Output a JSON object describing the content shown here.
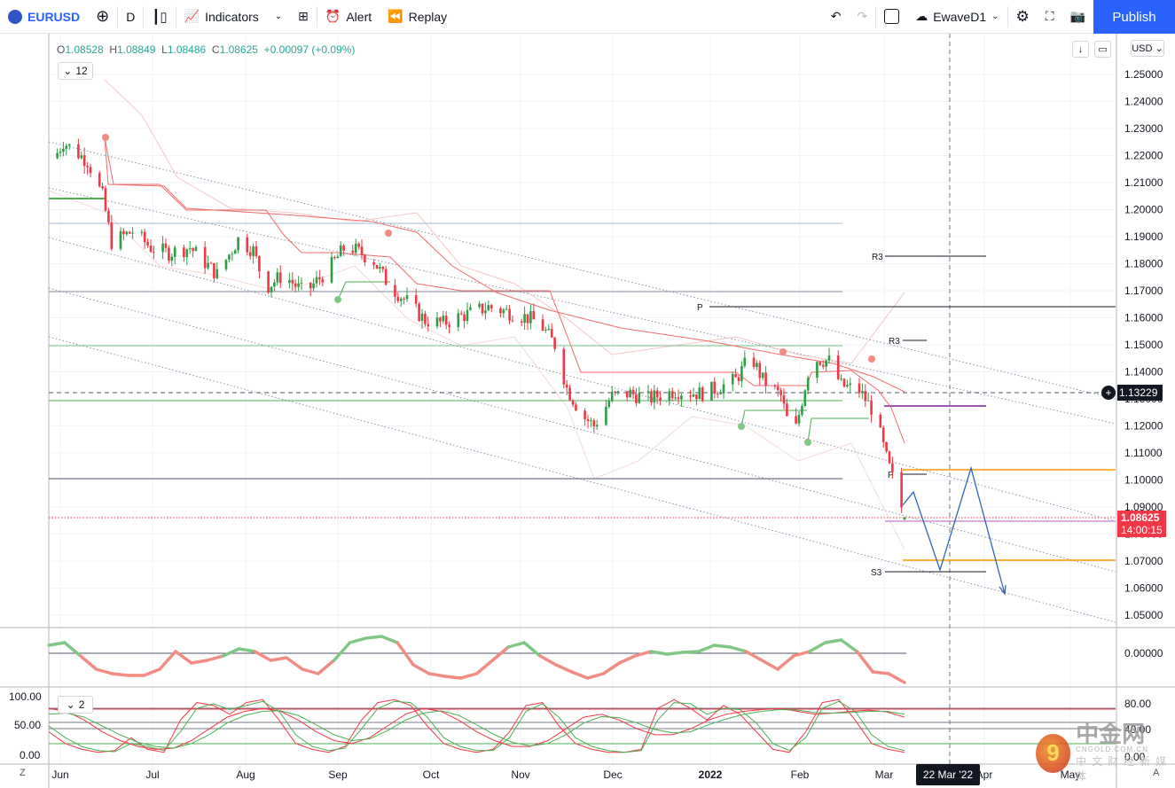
{
  "toolbar": {
    "symbol": "EURUSD",
    "interval": "D",
    "indicators": "Indicators",
    "alert": "Alert",
    "replay": "Replay",
    "layout_name": "EwaveD1",
    "publish": "Publish"
  },
  "legend": {
    "o_label": "O",
    "o": "1.08528",
    "h_label": "H",
    "h": "1.08849",
    "l_label": "L",
    "l": "1.08486",
    "c_label": "C",
    "c": "1.08625",
    "change": "+0.00097 (+0.09%)",
    "collapsed_count": "12",
    "osc_count": "2"
  },
  "currency": "USD",
  "price_tags": {
    "crosshair": "1.13229",
    "last": "1.08625",
    "countdown": "14:00:15"
  },
  "crosshair_date": "22 Mar '22",
  "levels": {
    "r3_a": "R3",
    "p_a": "P",
    "r3_b": "R3",
    "p_b": "P",
    "s3": "S3"
  },
  "zoom_button": "Z",
  "auto_button": "A",
  "watermark": {
    "name": "中金网",
    "sub": "CNGOLD.COM.CN",
    "cn": "中文财经新媒体"
  },
  "colors": {
    "up": "#2e9e44",
    "down": "#f23645",
    "accent": "#2962ff"
  },
  "chart_data": {
    "type": "candlestick",
    "symbol": "EURUSD",
    "timeframe": "D",
    "ylim": [
      1.045,
      1.26
    ],
    "y_ticks": [
      "1.25000",
      "1.24000",
      "1.23000",
      "1.22000",
      "1.21000",
      "1.20000",
      "1.19000",
      "1.18000",
      "1.17000",
      "1.16000",
      "1.15000",
      "1.14000",
      "1.13000",
      "1.12000",
      "1.11000",
      "1.10000",
      "1.09000",
      "1.08000",
      "1.07000",
      "1.06000",
      "1.05000"
    ],
    "x_ticks": [
      "Jun",
      "Jul",
      "Aug",
      "Sep",
      "Oct",
      "Nov",
      "Dec",
      "2022",
      "Feb",
      "Mar",
      "Apr",
      "May"
    ],
    "close_path": [
      [
        "2021-05-30",
        1.219
      ],
      [
        "2021-06-02",
        1.225
      ],
      [
        "2021-06-10",
        1.218
      ],
      [
        "2021-06-15",
        1.205
      ],
      [
        "2021-06-18",
        1.188
      ],
      [
        "2021-06-25",
        1.192
      ],
      [
        "2021-07-01",
        1.186
      ],
      [
        "2021-07-07",
        1.184
      ],
      [
        "2021-07-14",
        1.186
      ],
      [
        "2021-07-23",
        1.176
      ],
      [
        "2021-07-30",
        1.189
      ],
      [
        "2021-08-04",
        1.185
      ],
      [
        "2021-08-08",
        1.171
      ],
      [
        "2021-08-14",
        1.176
      ],
      [
        "2021-08-21",
        1.169
      ],
      [
        "2021-08-29",
        1.178
      ],
      [
        "2021-09-04",
        1.187
      ],
      [
        "2021-09-13",
        1.181
      ],
      [
        "2021-09-18",
        1.172
      ],
      [
        "2021-09-24",
        1.166
      ],
      [
        "2021-09-30",
        1.159
      ],
      [
        "2021-10-06",
        1.158
      ],
      [
        "2021-10-13",
        1.161
      ],
      [
        "2021-10-21",
        1.164
      ],
      [
        "2021-10-28",
        1.162
      ],
      [
        "2021-11-03",
        1.16
      ],
      [
        "2021-11-07",
        1.158
      ],
      [
        "2021-11-12",
        1.15
      ],
      [
        "2021-11-16",
        1.134
      ],
      [
        "2021-11-21",
        1.124
      ],
      [
        "2021-11-25",
        1.12
      ],
      [
        "2021-12-01",
        1.131
      ],
      [
        "2021-12-07",
        1.132
      ],
      [
        "2021-12-13",
        1.13
      ],
      [
        "2021-12-22",
        1.133
      ],
      [
        "2021-12-30",
        1.132
      ],
      [
        "2022-01-05",
        1.134
      ],
      [
        "2022-01-11",
        1.137
      ],
      [
        "2022-01-16",
        1.146
      ],
      [
        "2022-01-20",
        1.137
      ],
      [
        "2022-01-26",
        1.131
      ],
      [
        "2022-01-30",
        1.114
      ],
      [
        "2022-02-05",
        1.145
      ],
      [
        "2022-02-11",
        1.144
      ],
      [
        "2022-02-15",
        1.135
      ],
      [
        "2022-02-21",
        1.133
      ],
      [
        "2022-02-26",
        1.125
      ],
      [
        "2022-03-02",
        1.108
      ],
      [
        "2022-03-07",
        1.09
      ],
      [
        "2022-03-08",
        1.08625
      ]
    ],
    "oscillator": {
      "zero_label": "0.00000",
      "values": [
        0.0018,
        0.0024,
        -0.0006,
        -0.0036,
        -0.0046,
        -0.005,
        -0.005,
        -0.0036,
        0.0004,
        -0.0022,
        -0.0016,
        -0.0006,
        0.001,
        0.0004,
        -0.0016,
        -0.001,
        -0.0036,
        -0.0046,
        -0.0016,
        0.0024,
        0.0034,
        0.0038,
        0.0024,
        -0.0026,
        -0.0046,
        -0.0052,
        -0.0056,
        -0.0046,
        -0.0016,
        0.0014,
        0.0024,
        -0.0006,
        -0.0026,
        -0.0042,
        -0.0056,
        -0.0046,
        -0.0022,
        -0.0006,
        0.0004,
        -0.0002,
        0.0002,
        0.0004,
        0.0018,
        0.0014,
        0.0004,
        -0.0016,
        -0.0036,
        -0.0006,
        0.0004,
        0.0024,
        0.003,
        0.0004,
        -0.0042,
        -0.0046,
        -0.0066
      ]
    },
    "stochastic": {
      "left_ticks": [
        "100.00",
        "50.00",
        "0.00"
      ],
      "right_ticks": [
        "80.00",
        "40.00",
        "0.00"
      ],
      "fast_k": [
        40,
        20,
        10,
        5,
        8,
        30,
        10,
        5,
        60,
        90,
        85,
        70,
        90,
        95,
        60,
        20,
        10,
        5,
        15,
        60,
        90,
        95,
        85,
        50,
        20,
        10,
        5,
        10,
        40,
        85,
        90,
        50,
        20,
        10,
        5,
        5,
        10,
        80,
        95,
        80,
        60,
        85,
        70,
        40,
        10,
        5,
        40,
        90,
        95,
        60,
        20,
        10,
        5
      ],
      "fast_d": [
        50,
        30,
        15,
        8,
        6,
        20,
        15,
        8,
        40,
        80,
        88,
        78,
        85,
        92,
        75,
        35,
        15,
        8,
        12,
        45,
        80,
        92,
        90,
        65,
        30,
        15,
        8,
        8,
        30,
        75,
        88,
        65,
        30,
        15,
        8,
        5,
        8,
        60,
        90,
        88,
        70,
        80,
        78,
        55,
        20,
        8,
        30,
        80,
        92,
        75,
        35,
        15,
        8
      ],
      "slow_k": [
        80,
        75,
        60,
        40,
        25,
        15,
        10,
        12,
        25,
        45,
        65,
        75,
        80,
        75,
        60,
        40,
        25,
        20,
        30,
        50,
        70,
        80,
        75,
        60,
        40,
        25,
        15,
        15,
        25,
        45,
        65,
        70,
        60,
        45,
        35,
        35,
        45,
        60,
        70,
        75,
        78,
        80,
        75,
        70,
        72,
        75,
        77,
        74,
        65
      ],
      "slow_d": [
        70,
        72,
        65,
        50,
        35,
        22,
        15,
        12,
        20,
        35,
        55,
        68,
        75,
        76,
        68,
        52,
        35,
        25,
        28,
        42,
        60,
        72,
        76,
        68,
        52,
        35,
        22,
        16,
        20,
        35,
        55,
        66,
        64,
        55,
        44,
        38,
        40,
        52,
        62,
        70,
        75,
        78,
        77,
        73,
        72,
        73,
        75,
        75,
        70
      ]
    }
  }
}
